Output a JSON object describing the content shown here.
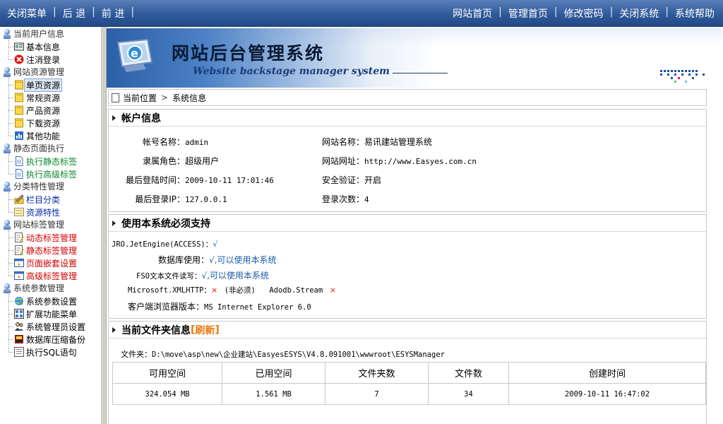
{
  "topbar": {
    "left": [
      "关闭菜单",
      "后 退",
      "前 进"
    ],
    "right": [
      "网站首页",
      "管理首页",
      "修改密码",
      "关闭系统",
      "系统帮助"
    ]
  },
  "sidebar": {
    "groups": [
      {
        "label": "当前用户信息",
        "items": [
          {
            "label": "基本信息",
            "icon": "id-card-icon",
            "color": "#000000"
          },
          {
            "label": "注消登录",
            "icon": "logout-x-icon",
            "color": "#000000"
          }
        ]
      },
      {
        "label": "网站资源管理",
        "items": [
          {
            "label": "单页资源",
            "icon": "folder-icon",
            "color": "#000000",
            "selected": true
          },
          {
            "label": "常规资源",
            "icon": "folder-icon",
            "color": "#000000"
          },
          {
            "label": "产品资源",
            "icon": "folder-icon",
            "color": "#000000"
          },
          {
            "label": "下载资源",
            "icon": "folder-icon",
            "color": "#000000"
          },
          {
            "label": "其他功能",
            "icon": "chart-icon",
            "color": "#000000"
          }
        ]
      },
      {
        "label": "静态页面执行",
        "items": [
          {
            "label": "执行静态标签",
            "icon": "page-icon",
            "color": "#0a8a2a"
          },
          {
            "label": "执行高级标签",
            "icon": "page-icon",
            "color": "#0a8a2a"
          }
        ]
      },
      {
        "label": "分类特性管理",
        "items": [
          {
            "label": "栏目分类",
            "icon": "pencil-icon",
            "color": "#0b2aa8"
          },
          {
            "label": "资源特性",
            "icon": "form-icon",
            "color": "#0b2aa8"
          }
        ]
      },
      {
        "label": "网站标签管理",
        "items": [
          {
            "label": "动态标签管理",
            "icon": "list-pencil-icon",
            "color": "#d10000"
          },
          {
            "label": "静态标签管理",
            "icon": "list-pencil-icon",
            "color": "#d10000"
          },
          {
            "label": "页面嵌套设置",
            "icon": "window-icon",
            "color": "#d10000"
          },
          {
            "label": "高级标签管理",
            "icon": "window-icon",
            "color": "#d10000"
          }
        ]
      },
      {
        "label": "系统参数管理",
        "items": [
          {
            "label": "系统参数设置",
            "icon": "globe-gear-icon",
            "color": "#000000"
          },
          {
            "label": "扩展功能菜单",
            "icon": "grid-icon",
            "color": "#000000"
          },
          {
            "label": "系统管理员设置",
            "icon": "users-icon",
            "color": "#000000"
          },
          {
            "label": "数据库压缩备份",
            "icon": "database-icon",
            "color": "#000000"
          },
          {
            "label": "执行SQL语句",
            "icon": "sql-icon",
            "color": "#000000"
          }
        ]
      }
    ]
  },
  "banner": {
    "title": "网站后台管理系统",
    "subtitle": "Website backstage manager system"
  },
  "crumb": {
    "label": "当前位置",
    "page": "系统信息"
  },
  "account": {
    "title": "帐户信息",
    "rows": [
      {
        "k1": "帐号名称：",
        "v1": "admin",
        "k2": "网站名称：",
        "v2": "易讯建站管理系统",
        "v2z": true
      },
      {
        "k1": "隶属角色：",
        "v1": "超级用户",
        "v1z": true,
        "k2": "网站网址：",
        "v2": "http://www.Easyes.com.cn"
      },
      {
        "k1": "最后登陆时间：",
        "v1": "2009-10-11 17:01:46",
        "k2": "安全验证：",
        "v2": "开启",
        "v2z": true
      },
      {
        "k1": "最后登录IP：",
        "v1": "127.0.0.1",
        "k2": "登录次数：",
        "v2": "4"
      }
    ]
  },
  "support": {
    "title": "使用本系统必须支持",
    "jro_label": "JRO.JetEngine(ACCESS)：",
    "jro_value": "√",
    "db_label": "数据库使用：",
    "db_value": "√,可以使用本系统",
    "fso_label": "FSO文本文件读写：",
    "fso_value": "√,可以使用本系统",
    "xml_label": "Microsoft.XMLHTTP：",
    "xml_value": "×",
    "xml_note": "(非必须)",
    "adodb_label": "Adodb.Stream",
    "adodb_value": "×",
    "browser_label": "客户端浏览器版本：",
    "browser_value": "MS Internet Explorer 6.0"
  },
  "folder": {
    "title": "当前文件夹信息",
    "refresh": "刷新",
    "path_label": "文件夹：",
    "path": "D:\\move\\asp\\new\\企业建站\\EasyesESYS\\V4.8.091001\\wwwroot\\ESYSManager",
    "headers": [
      "可用空间",
      "已用空间",
      "文件夹数",
      "文件数",
      "创建时间"
    ],
    "values": [
      "324.054 MB",
      "1.561 MB",
      "7",
      "34",
      "2009-10-11 16:47:02"
    ]
  }
}
